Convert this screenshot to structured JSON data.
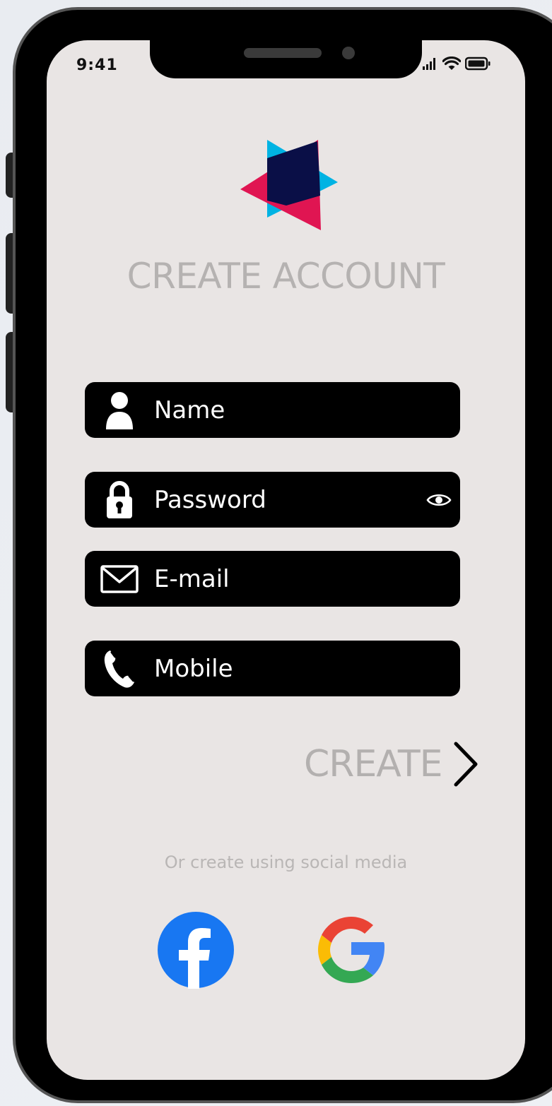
{
  "status_bar": {
    "time": "9:41"
  },
  "header": {
    "title": "CREATE ACCOUNT"
  },
  "form": {
    "name_placeholder": "Name",
    "password_placeholder": "Password",
    "email_placeholder": "E-mail",
    "mobile_placeholder": "Mobile"
  },
  "actions": {
    "create_label": "CREATE"
  },
  "social": {
    "prompt": "Or create using social media",
    "providers": [
      "facebook",
      "google"
    ]
  },
  "icons": {
    "name": "person-icon",
    "password": "lock-icon",
    "reveal": "eye-icon",
    "email": "envelope-icon",
    "mobile": "phone-icon",
    "next": "chevron-right-icon"
  },
  "colors": {
    "screen_bg": "#e9e5e4",
    "field_bg": "#000000",
    "muted_text": "#b5b2b1",
    "logo_red": "#e01552",
    "logo_blue": "#00b3e3",
    "logo_navy": "#0a0f47",
    "facebook_blue": "#1877f2"
  }
}
